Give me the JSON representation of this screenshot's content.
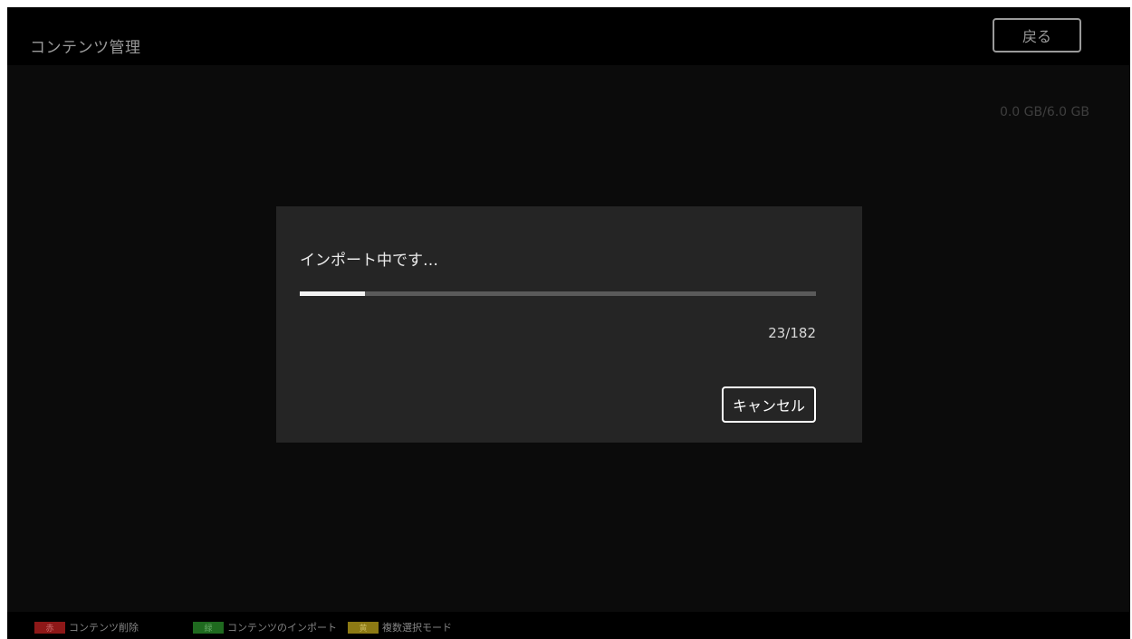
{
  "header": {
    "title": "コンテンツ管理",
    "back_label": "戻る"
  },
  "storage": {
    "usage_text": "0.0 GB/6.0 GB"
  },
  "dialog": {
    "title": "インポート中です…",
    "progress": {
      "current": 23,
      "total": 182,
      "text": "23/182"
    },
    "cancel_label": "キャンセル"
  },
  "footer": {
    "hints": [
      {
        "key": "赤",
        "key_color": "#8e1818",
        "label": "コンテンツ削除"
      },
      {
        "key": "緑",
        "key_color": "#1f6a1f",
        "label": "コンテンツのインポート"
      },
      {
        "key": "黄",
        "key_color": "#8d7a14",
        "label": "複数選択モード"
      }
    ]
  },
  "colors": {
    "background": "#0b0b0b",
    "dialog_background": "#252525",
    "progress_fill": "#f2f2f2",
    "progress_track": "#5a5a5a"
  }
}
